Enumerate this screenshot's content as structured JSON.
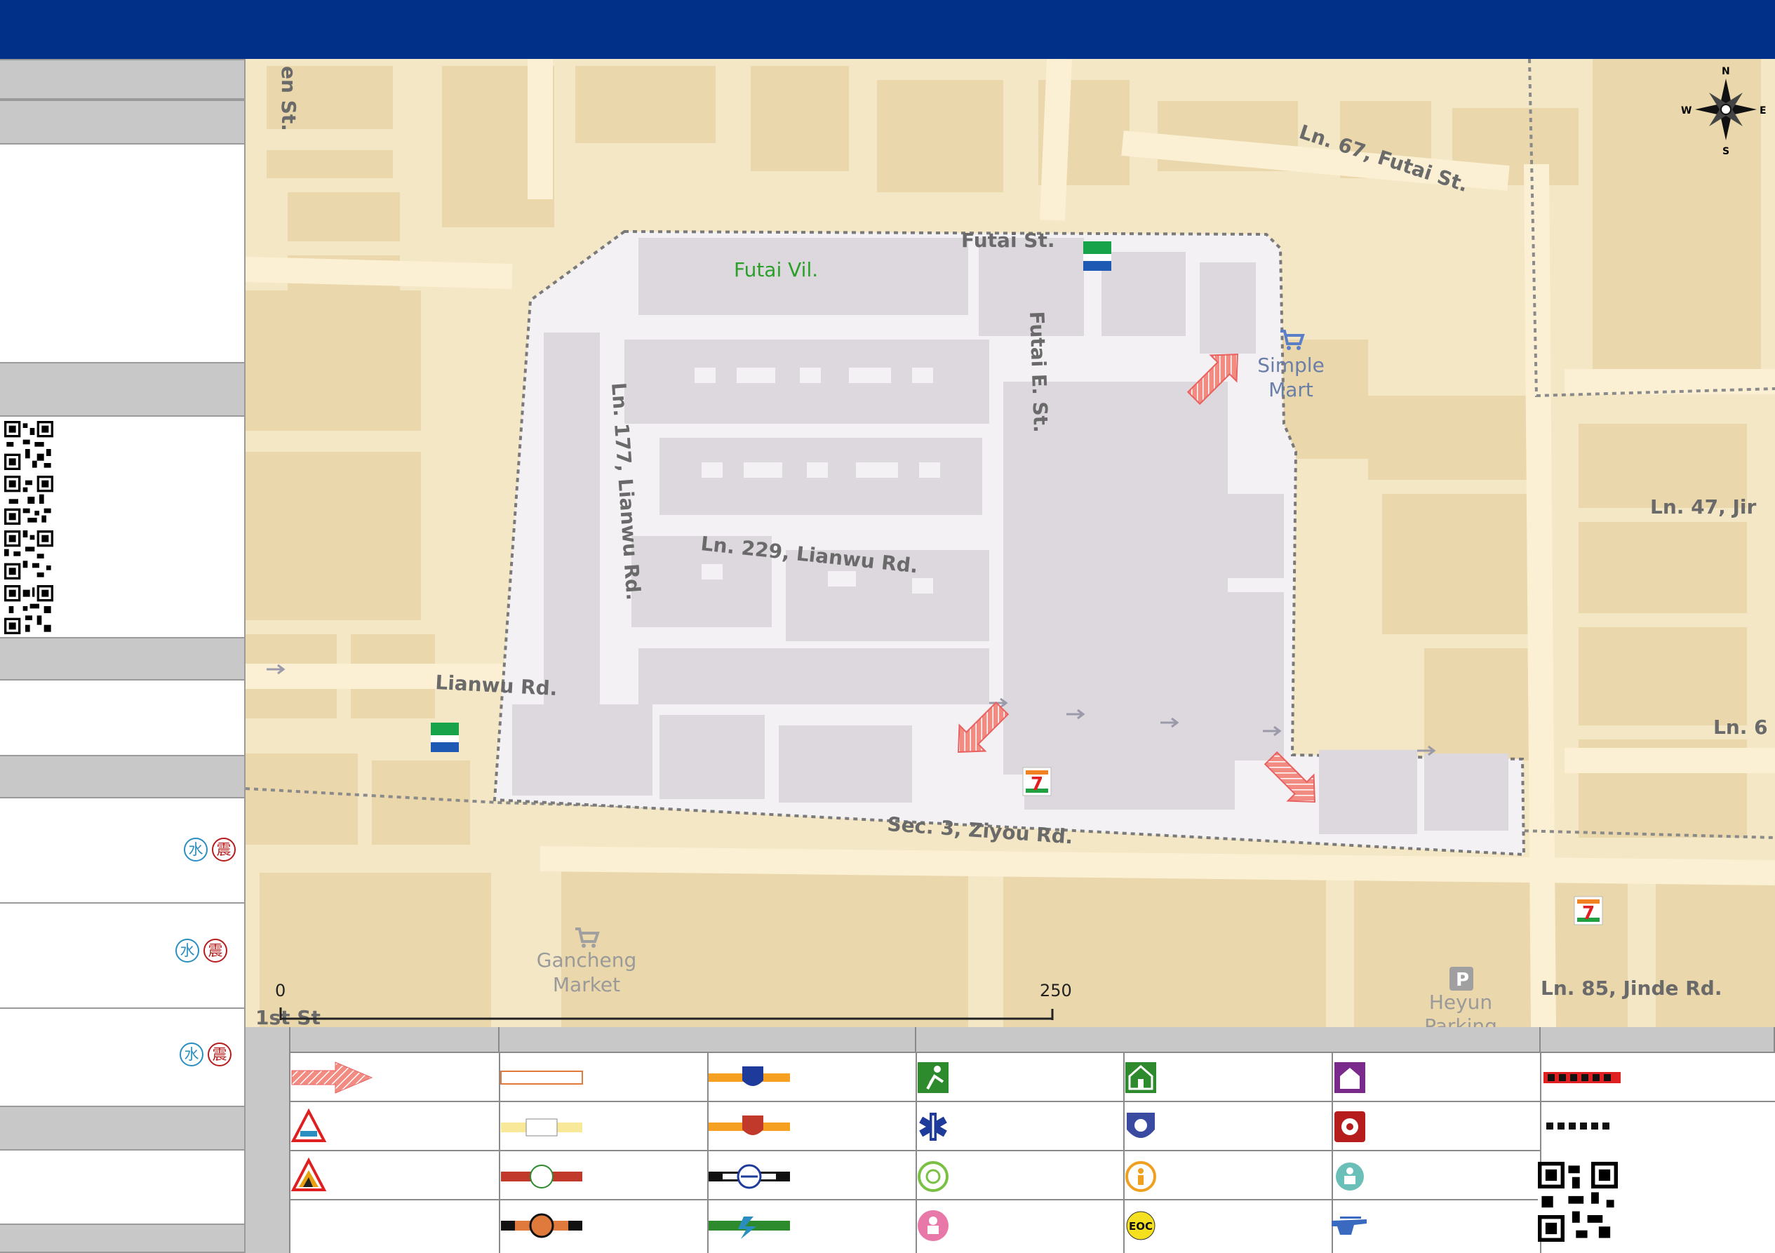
{
  "map": {
    "streets": {
      "futai_st": "Futai St.",
      "ln67_futai": "Ln. 67, Futai St.",
      "futai_e_st": "Futai E. St.",
      "ln177_lianwu": "Ln. 177, Lianwu Rd.",
      "ln229_lianwu": "Ln. 229, Lianwu Rd.",
      "lianwu_rd": "Lianwu Rd.",
      "ziyou_rd": "Sec. 3, Ziyou Rd.",
      "ln47": "Ln. 47, Jir",
      "ln6": "Ln. 6",
      "ln85_jinde": "Ln. 85, Jinde Rd.",
      "edge_st": "en St.",
      "bottom_st": "1st St"
    },
    "places": {
      "village": "Futai Vil.",
      "simple_mart_1": "Simple",
      "simple_mart_2": "Mart",
      "gancheng_1": "Gancheng",
      "gancheng_2": "Market",
      "heyun_1": "Heyun",
      "heyun_2": "Parking"
    },
    "compass": {
      "n": "N",
      "s": "S",
      "e": "E",
      "w": "W"
    },
    "scale": {
      "start": "0",
      "mid": "250"
    }
  },
  "sidebar": {
    "badges": {
      "water": "水",
      "quake": "震"
    }
  },
  "legend": {
    "eoc_label": "EOC"
  },
  "colors": {
    "title_bar": "#003087",
    "panel_gray": "#c8c8c8",
    "map_bg": "#f4e7c6",
    "evac_arrow": "#f07070",
    "village_label": "#2aa02a"
  }
}
